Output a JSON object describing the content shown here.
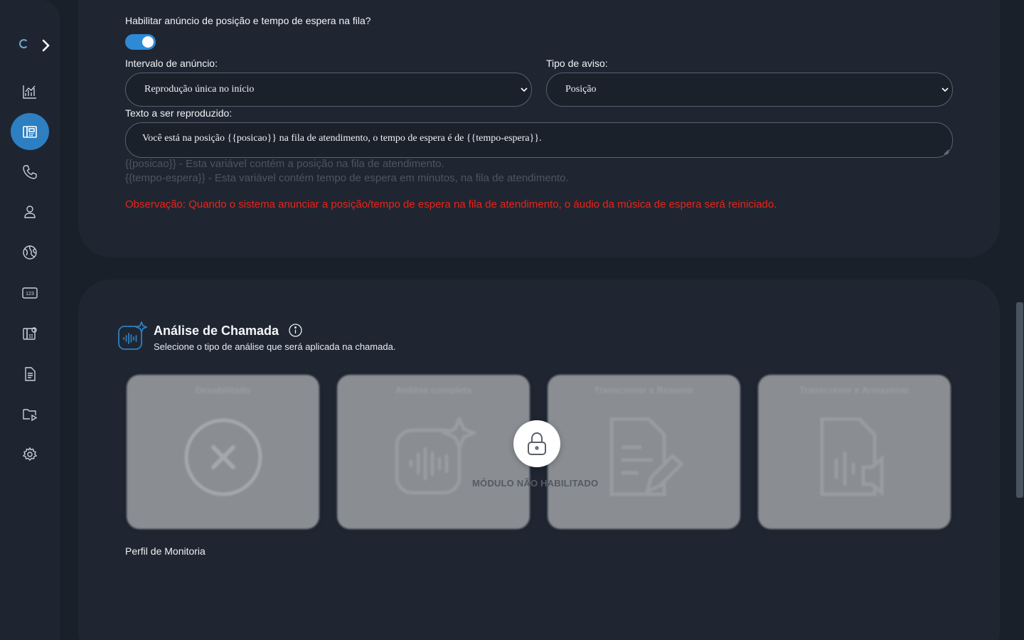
{
  "sidebar": {
    "items": [
      {
        "icon": "chart-icon",
        "active": false
      },
      {
        "icon": "pbx-icon",
        "active": true
      },
      {
        "icon": "phone-icon",
        "active": false
      },
      {
        "icon": "user-icon",
        "active": false
      },
      {
        "icon": "globe-icon",
        "active": false
      },
      {
        "icon": "numbers-icon",
        "active": false
      },
      {
        "icon": "pbx-settings-icon",
        "active": false
      },
      {
        "icon": "document-icon",
        "active": false
      },
      {
        "icon": "media-folder-icon",
        "active": false
      },
      {
        "icon": "gear-icon",
        "active": false
      }
    ],
    "numbers_icon_text": "123"
  },
  "announcement": {
    "enable_label": "Habilitar anúncio de posição e tempo de espera na fila?",
    "enabled": true,
    "interval_label": "Intervalo de anúncio:",
    "interval_value": "Reprodução única no início",
    "type_label": "Tipo de aviso:",
    "type_value": "Posição",
    "text_label": "Texto a ser reproduzido:",
    "text_value": "Você está na posição {{posicao}} na fila de atendimento, o tempo de espera é de {{tempo-espera}}.",
    "hint_position": "{{posicao}} - Esta variável contém a posição na fila de atendimento.",
    "hint_wait": "{{tempo-espera}} - Esta variável contém tempo de espera em minutos, na fila de atendimento.",
    "observation": "Observação: Quando o sistema anunciar a posição/tempo de espera na fila de atendimento, o áudio da música de espera será reiniciado."
  },
  "call_analysis": {
    "title": "Análise de Chamada",
    "subtitle": "Selecione o tipo de análise que será aplicada na chamada.",
    "tiles": [
      {
        "label": "Desabilitado",
        "icon": "x-circle-icon"
      },
      {
        "label": "Análise completa",
        "icon": "audio-sparkle-icon"
      },
      {
        "label": "Transcrever e Resumir",
        "icon": "document-edit-icon"
      },
      {
        "label": "Transcrever e Armazenar",
        "icon": "audio-file-icon"
      }
    ],
    "locked_text": "MÓDULO NÃO HABILITADO",
    "accent": "#2d7fc2"
  },
  "monitoring_label": "Perfil de Monitoria"
}
